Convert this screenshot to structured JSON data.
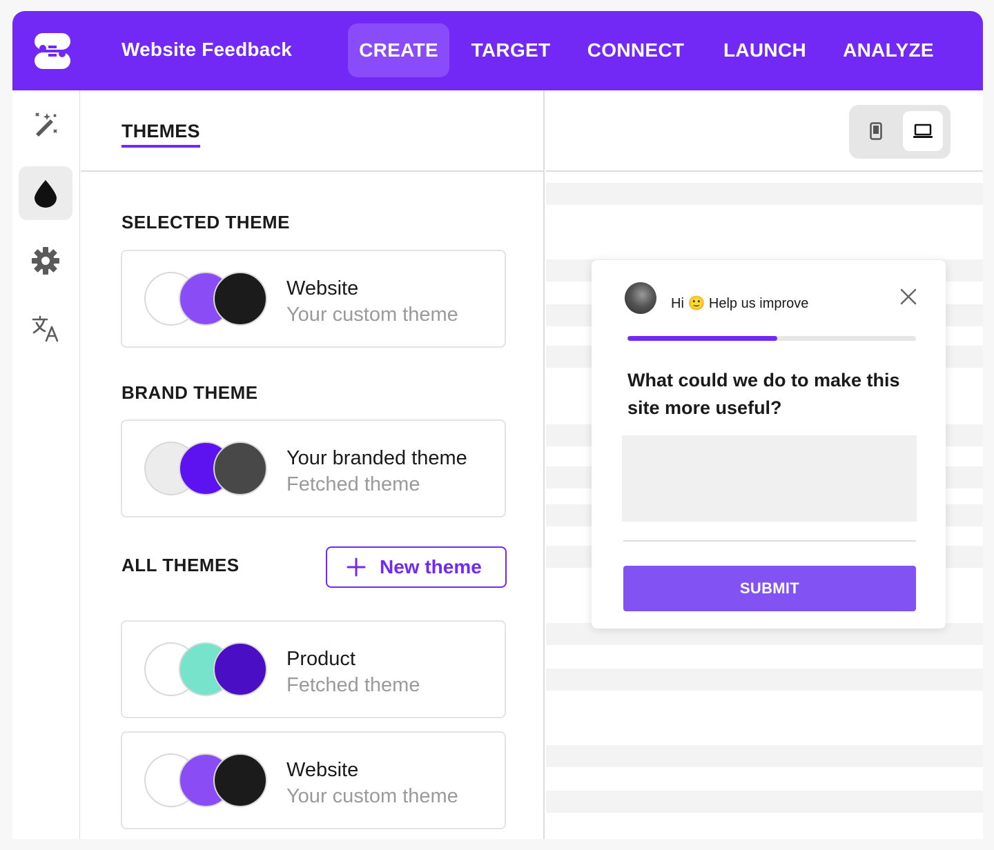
{
  "app": {
    "title": "Website Feedback",
    "brand_color": "#7329f5",
    "logo_icon": "survicate-logo"
  },
  "nav": {
    "tabs": [
      {
        "label": "CREATE",
        "active": true
      },
      {
        "label": "TARGET",
        "active": false
      },
      {
        "label": "CONNECT",
        "active": false
      },
      {
        "label": "LAUNCH",
        "active": false
      },
      {
        "label": "ANALYZE",
        "active": false
      }
    ]
  },
  "rail": {
    "items": [
      {
        "icon": "magic-wand-icon",
        "active": false
      },
      {
        "icon": "drop-icon",
        "active": true
      },
      {
        "icon": "gear-icon",
        "active": false
      },
      {
        "icon": "translate-icon",
        "active": false
      }
    ]
  },
  "themes_panel": {
    "tab_label": "THEMES",
    "selected_label": "SELECTED THEME",
    "brand_label": "BRAND  THEME",
    "all_label": "ALL  THEMES",
    "new_theme_label": "New theme",
    "selected_theme": {
      "name": "Website",
      "subtitle": "Your custom theme",
      "colors": [
        "#ffffff",
        "#8a4cf5",
        "#1b1b1b"
      ]
    },
    "brand_theme": {
      "name": "Your branded theme",
      "subtitle": "Fetched theme",
      "colors": [
        "#ececec",
        "#5d12f0",
        "#484848"
      ]
    },
    "all_themes": [
      {
        "name": "Product",
        "subtitle": "Fetched theme",
        "colors": [
          "#ffffff",
          "#76e4cb",
          "#4a0fc4"
        ]
      },
      {
        "name": "Website",
        "subtitle": "Your custom theme",
        "colors": [
          "#ffffff",
          "#8a4cf5",
          "#1b1b1b"
        ]
      }
    ]
  },
  "preview": {
    "device_options": [
      {
        "icon": "mobile-icon",
        "active": false
      },
      {
        "icon": "laptop-icon",
        "active": true
      }
    ],
    "survey": {
      "greeting": "Hi 🙂 Help us improve",
      "progress_fraction": 0.52,
      "question": "What could we do to make this site more useful?",
      "answer_value": "",
      "submit_label": "SUBMIT"
    }
  }
}
